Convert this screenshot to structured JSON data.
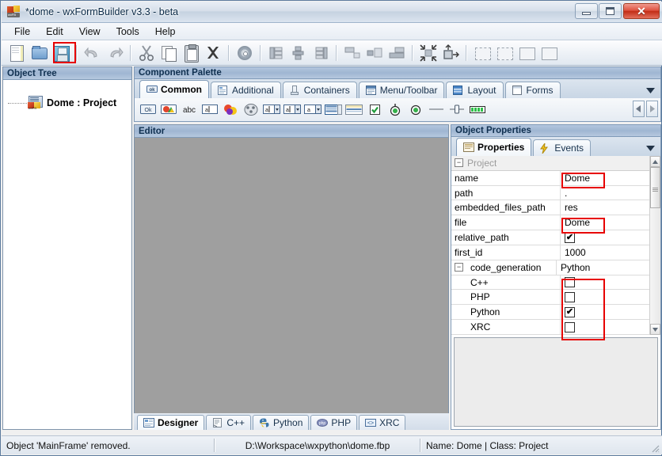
{
  "window": {
    "title": "*dome - wxFormBuilder v3.3 - beta",
    "icon": "wxfb-logo-icon",
    "buttons": {
      "minimize": "minimize-button",
      "maximize": "maximize-button",
      "close": "close-button"
    }
  },
  "menu": {
    "items": [
      {
        "label": "File"
      },
      {
        "label": "Edit"
      },
      {
        "label": "View"
      },
      {
        "label": "Tools"
      },
      {
        "label": "Help"
      }
    ]
  },
  "toolbar": {
    "items": [
      {
        "name": "new-icon",
        "tooltip": "New"
      },
      {
        "name": "open-icon",
        "tooltip": "Open"
      },
      {
        "name": "save-icon",
        "tooltip": "Save",
        "highlighted": true
      },
      {
        "name": "undo-icon",
        "tooltip": "Undo",
        "disabled": true
      },
      {
        "name": "redo-icon",
        "tooltip": "Redo",
        "disabled": true
      },
      {
        "name": "cut-icon",
        "tooltip": "Cut"
      },
      {
        "name": "copy-icon",
        "tooltip": "Copy"
      },
      {
        "name": "paste-icon",
        "tooltip": "Paste"
      },
      {
        "name": "delete-icon",
        "tooltip": "Delete"
      },
      {
        "name": "gear-icon",
        "tooltip": "Generate Code"
      },
      {
        "name": "align-left-icon",
        "tooltip": "Align Left"
      },
      {
        "name": "align-center-icon",
        "tooltip": "Align Center"
      },
      {
        "name": "align-right-icon",
        "tooltip": "Align Right"
      },
      {
        "name": "align-top-icon",
        "tooltip": "Align Top"
      },
      {
        "name": "align-middle-icon",
        "tooltip": "Align Middle"
      },
      {
        "name": "align-bottom-icon",
        "tooltip": "Align Bottom"
      },
      {
        "name": "expand-icon",
        "tooltip": "Expand"
      },
      {
        "name": "stretch-icon",
        "tooltip": "Stretch"
      },
      {
        "name": "border-left-icon",
        "tooltip": "Border Left"
      },
      {
        "name": "border-right-icon",
        "tooltip": "Border Right"
      },
      {
        "name": "border-top-icon",
        "tooltip": "Border Top"
      },
      {
        "name": "border-bottom-icon",
        "tooltip": "Border Bottom"
      }
    ]
  },
  "object_tree": {
    "caption": "Object Tree",
    "nodes": [
      {
        "label": "Dome : Project",
        "icon": "project-icon"
      }
    ]
  },
  "component_palette": {
    "caption": "Component Palette",
    "tabs": [
      {
        "label": "Common",
        "icon": "button-icon",
        "active": true
      },
      {
        "label": "Additional",
        "icon": "additional-icon",
        "active": false
      },
      {
        "label": "Containers",
        "icon": "containers-icon",
        "active": false
      },
      {
        "label": "Menu/Toolbar",
        "icon": "menubar-icon",
        "active": false
      },
      {
        "label": "Layout",
        "icon": "layout-icon",
        "active": false
      },
      {
        "label": "Forms",
        "icon": "forms-icon",
        "active": false
      }
    ],
    "dropdown": "chevron-down-icon",
    "items": [
      {
        "name": "wxbutton-icon",
        "label": "Ok"
      },
      {
        "name": "wxbitmapbutton-icon",
        "label": ""
      },
      {
        "name": "wxstatictext-icon",
        "label": "abc"
      },
      {
        "name": "wxtextctrl-icon",
        "label": "a"
      },
      {
        "name": "wxstaticbitmap-icon",
        "label": ""
      },
      {
        "name": "wxanimationctrl-icon",
        "label": ""
      },
      {
        "name": "wxcombobox-icon",
        "label": "a"
      },
      {
        "name": "wxchoice-icon",
        "label": "a"
      },
      {
        "name": "wxbitmapcombobox-icon",
        "label": "a"
      },
      {
        "name": "wxlistbox-icon",
        "label": ""
      },
      {
        "name": "wxlistctrl-icon",
        "label": ""
      },
      {
        "name": "wxcheckbox-icon",
        "label": ""
      },
      {
        "name": "wxradiobutton-icon",
        "label": ""
      },
      {
        "name": "wxradiobox-icon",
        "label": ""
      },
      {
        "name": "wxstaticline-icon",
        "label": ""
      },
      {
        "name": "wxslider-icon",
        "label": ""
      },
      {
        "name": "wxgauge-icon",
        "label": ""
      }
    ],
    "scroll_left": "scroll-left-icon",
    "scroll_right": "scroll-right-icon"
  },
  "editor": {
    "caption": "Editor",
    "tabs": [
      {
        "label": "Designer",
        "icon": "designer-icon",
        "active": true
      },
      {
        "label": "C++",
        "icon": "cpp-icon",
        "active": false
      },
      {
        "label": "Python",
        "icon": "python-icon",
        "active": false
      },
      {
        "label": "PHP",
        "icon": "php-icon",
        "active": false
      },
      {
        "label": "XRC",
        "icon": "xrc-icon",
        "active": false
      }
    ]
  },
  "object_properties": {
    "caption": "Object Properties",
    "tabs": [
      {
        "label": "Properties",
        "icon": "properties-icon",
        "active": true
      },
      {
        "label": "Events",
        "icon": "events-icon",
        "active": false
      }
    ],
    "dropdown": "chevron-down-icon",
    "category": "Project",
    "rows": [
      {
        "name": "name",
        "value": "Dome",
        "type": "text",
        "highlighted": true,
        "indent": false
      },
      {
        "name": "path",
        "value": ".",
        "type": "text",
        "highlighted": false,
        "indent": false
      },
      {
        "name": "embedded_files_path",
        "value": "res",
        "type": "text",
        "highlighted": false,
        "indent": false
      },
      {
        "name": "file",
        "value": "Dome",
        "type": "text",
        "highlighted": true,
        "indent": false
      },
      {
        "name": "relative_path",
        "value": "",
        "type": "checkbox",
        "checked": true,
        "indent": false
      },
      {
        "name": "first_id",
        "value": "1000",
        "type": "text",
        "highlighted": false,
        "indent": false
      },
      {
        "name": "code_generation",
        "value": "Python",
        "type": "category-value",
        "highlighted": false,
        "indent": false
      },
      {
        "name": "C++",
        "value": "",
        "type": "checkbox",
        "checked": false,
        "indent": true
      },
      {
        "name": "PHP",
        "value": "",
        "type": "checkbox",
        "checked": false,
        "indent": true
      },
      {
        "name": "Python",
        "value": "",
        "type": "checkbox",
        "checked": true,
        "indent": true
      },
      {
        "name": "XRC",
        "value": "",
        "type": "checkbox",
        "checked": false,
        "indent": true
      }
    ]
  },
  "status_bar": {
    "message": "Object 'MainFrame' removed.",
    "file_path": "D:\\Workspace\\wxpython\\dome.fbp",
    "selection": "Name: Dome | Class: Project"
  },
  "annotations": {
    "color": "#e70000",
    "boxes": [
      {
        "target": "save-toolbar-button"
      },
      {
        "target": "name-property-value"
      },
      {
        "target": "file-property-value"
      },
      {
        "target": "code-generation-checkboxes"
      }
    ]
  }
}
